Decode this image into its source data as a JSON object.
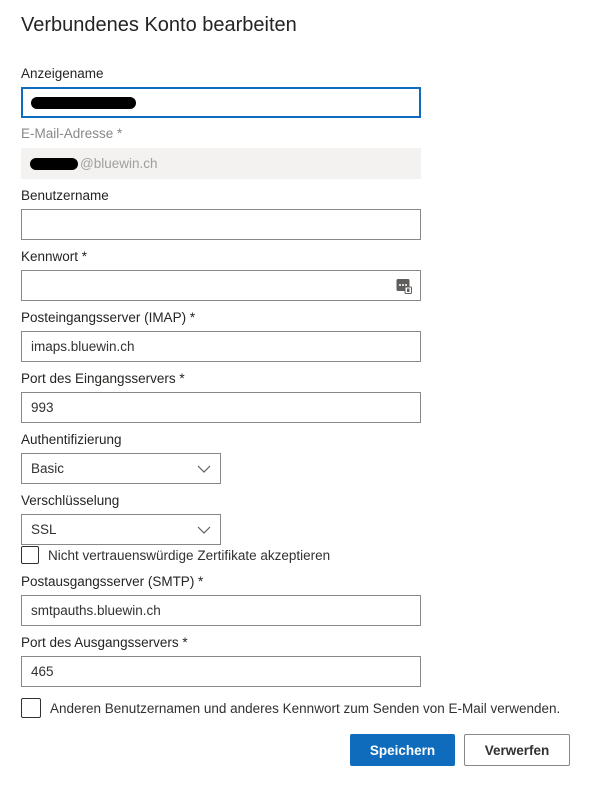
{
  "dialog": {
    "title": "Verbundenes Konto bearbeiten"
  },
  "fields": {
    "display_name": {
      "label": "Anzeigename",
      "value": ""
    },
    "email": {
      "label": "E-Mail-Adresse *",
      "value_suffix": "@bluewin.ch"
    },
    "username": {
      "label": "Benutzername",
      "value": ""
    },
    "password": {
      "label": "Kennwort *",
      "value": "",
      "icon": "password-reveal-icon"
    },
    "imap_server": {
      "label": "Posteingangsserver (IMAP) *",
      "value": "imaps.bluewin.ch"
    },
    "imap_port": {
      "label": "Port des Eingangsservers *",
      "value": "993"
    },
    "auth": {
      "label": "Authentifizierung",
      "value": "Basic"
    },
    "encryption": {
      "label": "Verschlüsselung",
      "value": "SSL"
    },
    "untrusted_certs": {
      "label": "Nicht vertrauenswürdige Zertifikate akzeptieren",
      "checked": false
    },
    "smtp_server": {
      "label": "Postausgangsserver (SMTP) *",
      "value": "smtpauths.bluewin.ch"
    },
    "smtp_port": {
      "label": "Port des Ausgangsservers *",
      "value": "465"
    },
    "different_credentials": {
      "label": "Anderen Benutzernamen und anderes Kennwort zum Senden von E-Mail verwenden.",
      "checked": false
    }
  },
  "buttons": {
    "save": "Speichern",
    "discard": "Verwerfen"
  },
  "colors": {
    "accent": "#0f6cbd",
    "border": "#8a8886",
    "readonly_bg": "#f3f2f1"
  }
}
